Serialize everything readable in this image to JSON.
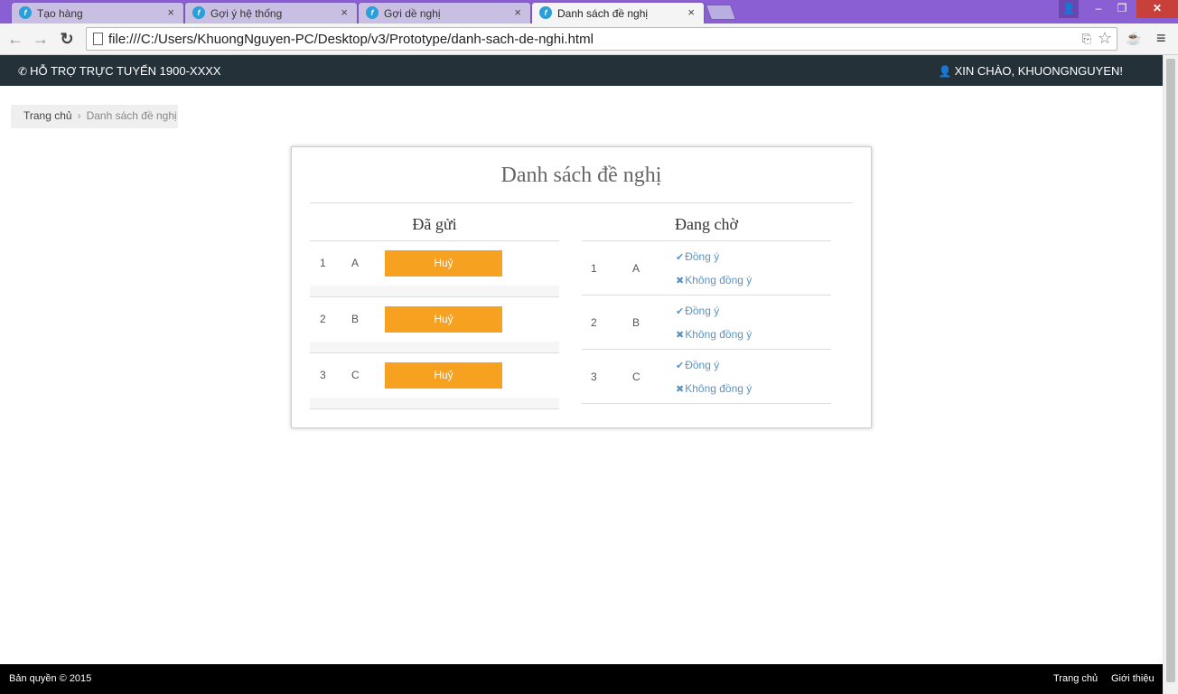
{
  "browser": {
    "tabs": [
      {
        "title": "Tạo hàng",
        "active": false
      },
      {
        "title": "Gợi ý hệ thống",
        "active": false
      },
      {
        "title": "Gợi dề nghị",
        "active": false
      },
      {
        "title": "Danh sách đề nghị",
        "active": true
      }
    ],
    "tab_close": "×",
    "favicon": "f",
    "url": "file:///C:/Users/KhuongNguyen-PC/Desktop/v3/Prototype/danh-sach-de-nghi.html",
    "icons": {
      "back": "←",
      "forward": "→",
      "reload": "↻",
      "translate": "⎘",
      "bookmark": "☆",
      "extension": "☕",
      "menu": "≡",
      "win_user": "👤",
      "minimize": "–",
      "maximize": "❐",
      "close": "✕"
    }
  },
  "topnav": {
    "support": "Hỗ trợ trực tuyến 1900-XXXX",
    "greeting": "Xin chào, KhuongNguyen!",
    "phone_icon": "✆",
    "user_icon": "👤"
  },
  "breadcrumb": {
    "home": "Trang chủ",
    "separator": "›",
    "current": "Danh sách đề nghị"
  },
  "panel": {
    "title": "Danh sách đề nghị",
    "sent": {
      "title": "Đã gửi",
      "rows": [
        {
          "num": "1",
          "name": "A",
          "action": "Huỷ"
        },
        {
          "num": "2",
          "name": "B",
          "action": "Huỷ"
        },
        {
          "num": "3",
          "name": "C",
          "action": "Huỷ"
        }
      ]
    },
    "pending": {
      "title": "Đang chờ",
      "rows": [
        {
          "num": "1",
          "name": "A",
          "accept": "Đồng ý",
          "reject": "Không đồng ý"
        },
        {
          "num": "2",
          "name": "B",
          "accept": "Đồng ý",
          "reject": "Không đồng ý"
        },
        {
          "num": "3",
          "name": "C",
          "accept": "Đồng ý",
          "reject": "Không đồng ý"
        }
      ],
      "accept_icon": "✔",
      "reject_icon": "✖"
    }
  },
  "footer": {
    "copyright": "Bản quyền © 2015",
    "links": [
      "Trang chủ",
      "Giới thiệu"
    ]
  },
  "colors": {
    "topnav_bg": "#243138",
    "cancel_button": "#f6a11f",
    "action_link": "#5b93c2",
    "footer_bg": "#000000",
    "chrome_frame": "#8b5fd4"
  }
}
